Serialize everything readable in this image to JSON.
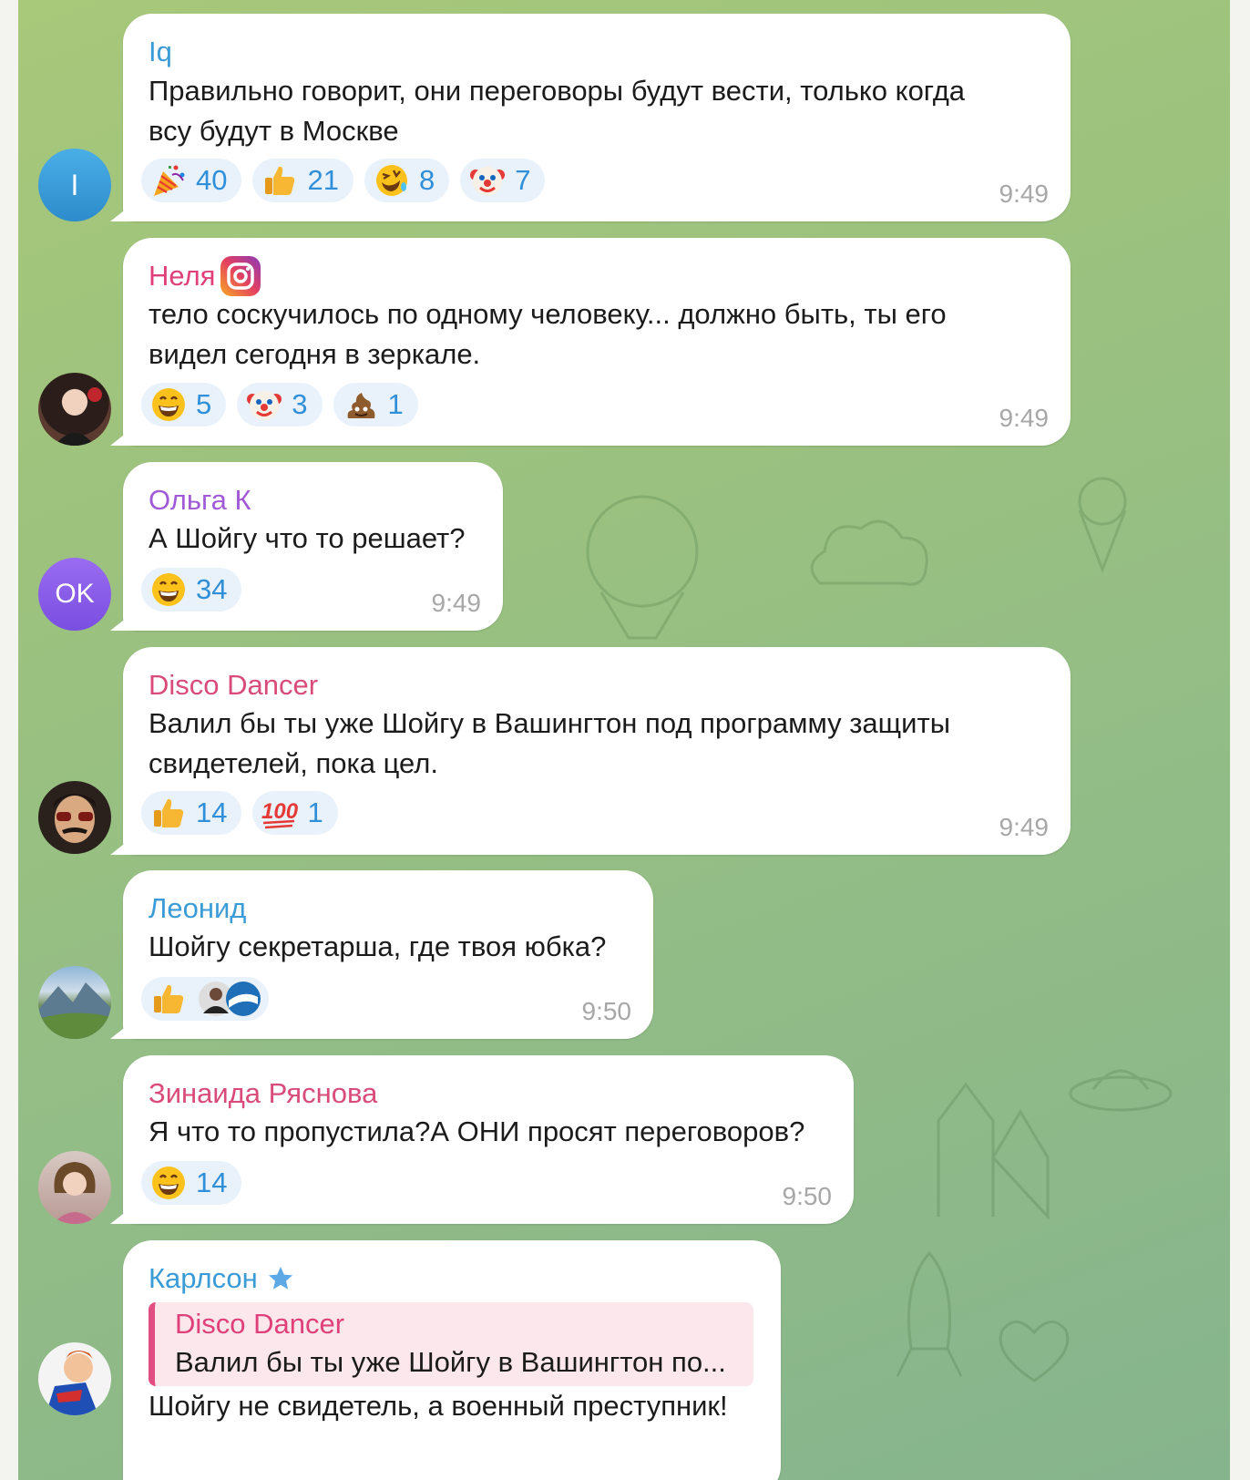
{
  "messages": [
    {
      "author": "Iq",
      "name_color": "#3a9bd6",
      "avatar_initials": "I",
      "avatar_color": "#3a9bd6",
      "lines": [
        "Правильно говорит, они переговоры будут вести, только когда",
        "всу будут в Москве"
      ],
      "reactions": [
        {
          "emoji": "party-popper",
          "count": "40"
        },
        {
          "emoji": "thumbs-up",
          "count": "21"
        },
        {
          "emoji": "rofl",
          "count": "8"
        },
        {
          "emoji": "clown",
          "count": "7"
        }
      ],
      "time": "9:49"
    },
    {
      "author": "Неля",
      "name_color": "#e0407a",
      "badge_icon": "instagram-icon",
      "avatar_icon": "photo-avatar-woman",
      "lines": [
        "тело соскучилось по одному человеку... должно быть, ты его",
        "видел сегодня в зеркале."
      ],
      "reactions": [
        {
          "emoji": "grin",
          "count": "5"
        },
        {
          "emoji": "clown",
          "count": "3"
        },
        {
          "emoji": "poop",
          "count": "1"
        }
      ],
      "time": "9:49"
    },
    {
      "author": "Ольга К",
      "name_color": "#a15ad6",
      "avatar_initials": "OK",
      "avatar_color": "#8e5ff0",
      "lines": [
        "А Шойгу что то решает?"
      ],
      "reactions": [
        {
          "emoji": "grin",
          "count": "34"
        }
      ],
      "time": "9:49"
    },
    {
      "author": "Disco Dancer",
      "name_color": "#d94c7a",
      "avatar_icon": "photo-avatar-man-sunglasses",
      "lines": [
        "Валил бы ты уже Шойгу в Вашингтон под программу защиты",
        "свидетелей, пока цел."
      ],
      "reactions": [
        {
          "emoji": "thumbs-up",
          "count": "14"
        },
        {
          "emoji": "hundred",
          "count": "1"
        }
      ],
      "time": "9:49"
    },
    {
      "author": "Леонид",
      "name_color": "#3a9bd6",
      "avatar_icon": "photo-avatar-mountains",
      "lines": [
        "Шойгу секретарша, где твоя юбка?"
      ],
      "reactions": [
        {
          "emoji": "thumbs-up",
          "count": ""
        }
      ],
      "reactor_avatars": [
        "reactor-avatar-1",
        "reactor-avatar-2"
      ],
      "time": "9:50"
    },
    {
      "author": "Зинаида Ряснова",
      "name_color": "#d94c7a",
      "avatar_icon": "photo-avatar-woman-2",
      "lines": [
        "Я что то пропустила?А ОНИ просят переговоров?"
      ],
      "reactions": [
        {
          "emoji": "grin",
          "count": "14"
        }
      ],
      "time": "9:50"
    },
    {
      "author": "Карлсон",
      "name_color": "#3a9bd6",
      "badge_icon": "star-icon",
      "avatar_icon": "photo-avatar-cartoon",
      "reply": {
        "author": "Disco Dancer",
        "text": "Валил бы ты уже Шойгу в Вашингтон по..."
      },
      "lines": [
        "Шойгу не свидетель, а военный преступник!"
      ]
    }
  ],
  "colors": {
    "reaction_bg": "#e9f2fb",
    "reaction_text": "#2f8fd8",
    "time_text": "#a7a7a7"
  }
}
